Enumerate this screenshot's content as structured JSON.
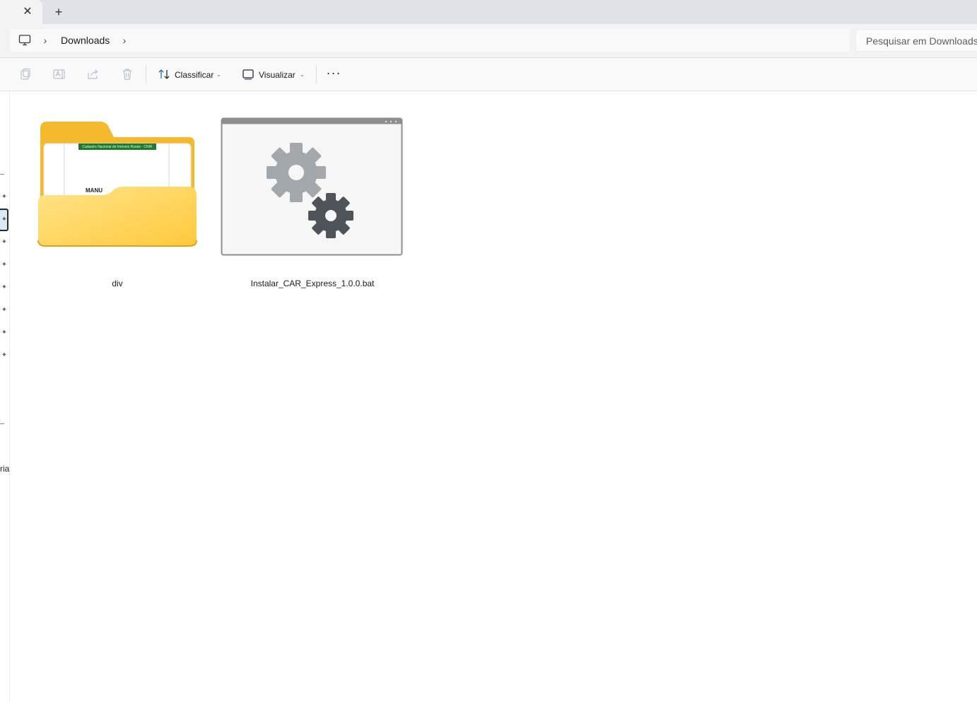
{
  "tabs": {
    "close_glyph": "✕",
    "new_tab_glyph": "+"
  },
  "address": {
    "location_icon": "computer-icon",
    "breadcrumb": [
      "Downloads"
    ],
    "chevron": "›",
    "search_placeholder": "Pesquisar em Downloads"
  },
  "commandbar": {
    "icons": [
      "copy-icon",
      "rename-icon",
      "share-icon",
      "delete-icon"
    ],
    "sort_label": "Classificar",
    "view_label": "Visualizar",
    "caret": "⌄",
    "more_glyph": "···"
  },
  "nav": {
    "pin_glyph": "📌",
    "partial_label": "ria"
  },
  "files": [
    {
      "name": "div",
      "icon": "folder-icon",
      "preview_text": "Cadastro Nacional de Imóveis Rurais - CNIR",
      "preview_heading": "MANU"
    },
    {
      "name": "Instalar_CAR_Express_1.0.0.bat",
      "icon": "batch-file-icon"
    }
  ],
  "colors": {
    "folder_back": "#f4b92d",
    "folder_front": "#ffd45a",
    "gear_light": "#9aa0a6",
    "gear_dark": "#4a4f55",
    "accent": "#2a6ebb"
  }
}
